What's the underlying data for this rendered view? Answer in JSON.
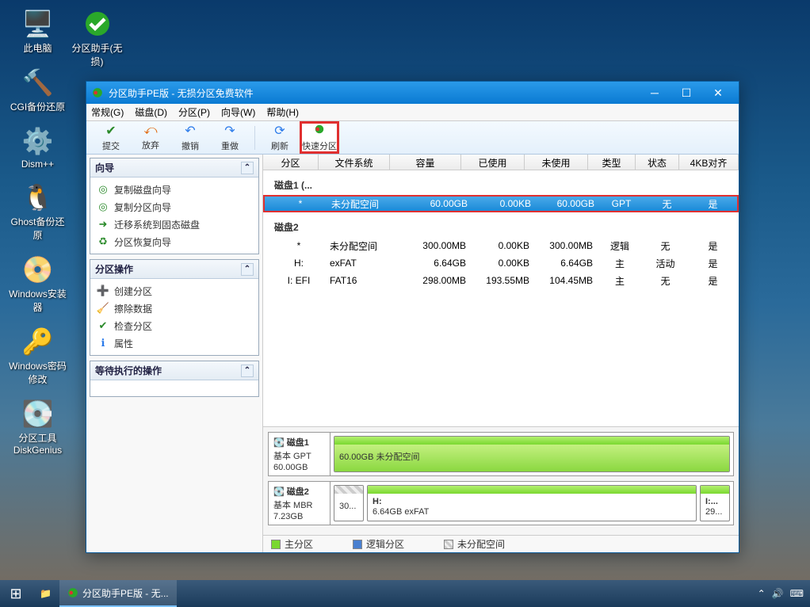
{
  "desktop": {
    "icons_col1": [
      {
        "label": "此电脑",
        "color": "#5ab0e8"
      },
      {
        "label": "CGI备份还原",
        "color": "#5a7aba"
      },
      {
        "label": "Dism++",
        "color": "#4aa9e0"
      },
      {
        "label": "Ghost备份还原",
        "color": "#f0b020"
      },
      {
        "label": "Windows安装器",
        "color": "#3a9ad8"
      },
      {
        "label": "Windows密码修改",
        "color": "#f0b020"
      },
      {
        "label": "分区工具DiskGenius",
        "color": "#e87020"
      }
    ],
    "icons_col2": [
      {
        "label": "分区助手(无损)",
        "color": "#2aa82a"
      }
    ]
  },
  "window": {
    "title": "分区助手PE版 - 无损分区免费软件"
  },
  "menus": [
    "常规(G)",
    "磁盘(D)",
    "分区(P)",
    "向导(W)",
    "帮助(H)"
  ],
  "toolbar": [
    {
      "label": "提交",
      "icon": "✔",
      "cls": ""
    },
    {
      "label": "放弃",
      "icon": "↶",
      "cls": ""
    },
    {
      "label": "撤销",
      "icon": "↩",
      "cls": ""
    },
    {
      "label": "重做",
      "icon": "↪",
      "cls": ""
    },
    {
      "sep": true
    },
    {
      "label": "刷新",
      "icon": "⟳",
      "cls": "blue"
    },
    {
      "label": "快速分区",
      "icon": "◐",
      "cls": "highlight"
    }
  ],
  "wizards": {
    "title": "向导",
    "items": [
      "复制磁盘向导",
      "复制分区向导",
      "迁移系统到固态磁盘",
      "分区恢复向导"
    ]
  },
  "ops": {
    "title": "分区操作",
    "items": [
      "创建分区",
      "擦除数据",
      "检查分区",
      "属性"
    ]
  },
  "pending": {
    "title": "等待执行的操作"
  },
  "columns": {
    "part": "分区",
    "fs": "文件系统",
    "cap": "容量",
    "used": "已使用",
    "free": "未使用",
    "type": "类型",
    "stat": "状态",
    "align": "4KB对齐"
  },
  "disks": [
    {
      "name": "磁盘1 (...",
      "rows": [
        {
          "part": "*",
          "fs": "未分配空间",
          "cap": "60.00GB",
          "used": "0.00KB",
          "free": "60.00GB",
          "type": "GPT",
          "stat": "无",
          "align": "是",
          "selected": true
        }
      ]
    },
    {
      "name": "磁盘2",
      "rows": [
        {
          "part": "*",
          "fs": "未分配空间",
          "cap": "300.00MB",
          "used": "0.00KB",
          "free": "300.00MB",
          "type": "逻辑",
          "stat": "无",
          "align": "是"
        },
        {
          "part": "H:",
          "fs": "exFAT",
          "cap": "6.64GB",
          "used": "0.00KB",
          "free": "6.64GB",
          "type": "主",
          "stat": "活动",
          "align": "是"
        },
        {
          "part": "I: EFI",
          "fs": "FAT16",
          "cap": "298.00MB",
          "used": "193.55MB",
          "free": "104.45MB",
          "type": "主",
          "stat": "无",
          "align": "是"
        }
      ]
    }
  ],
  "visual": {
    "disk1": {
      "name": "磁盘1",
      "type": "基本 GPT",
      "size": "60.00GB",
      "bar": {
        "label": "60.00GB 未分配空间"
      }
    },
    "disk2": {
      "name": "磁盘2",
      "type": "基本 MBR",
      "size": "7.23GB",
      "bars": [
        {
          "l1": "",
          "l2": "30..."
        },
        {
          "l1": "H:",
          "l2": "6.64GB exFAT"
        },
        {
          "l1": "I:...",
          "l2": "29..."
        }
      ]
    }
  },
  "legend": {
    "primary": "主分区",
    "logical": "逻辑分区",
    "free": "未分配空间"
  },
  "taskbar": {
    "app": "分区助手PE版 - 无..."
  }
}
